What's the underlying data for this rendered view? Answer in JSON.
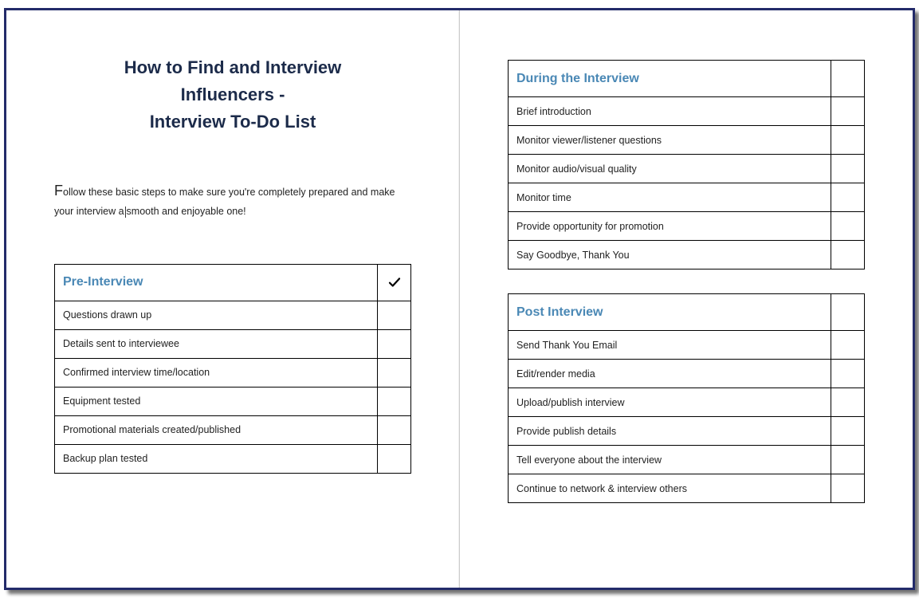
{
  "title": {
    "line1": "How to Find and Interview",
    "line2": "Influencers -",
    "line3": "Interview To-Do List"
  },
  "intro": {
    "first_letter": "F",
    "rest_before_cursor": "ollow these basic steps to make sure you're completely prepared and make your interview a",
    "rest_after_cursor": "smooth and enjoyable one!"
  },
  "sections": {
    "pre": {
      "heading": "Pre-Interview",
      "show_check_icon": true,
      "items": [
        "Questions drawn up",
        "Details sent to interviewee",
        "Confirmed interview time/location",
        "Equipment tested",
        "Promotional materials created/published",
        "Backup plan tested"
      ]
    },
    "during": {
      "heading": "During the Interview",
      "show_check_icon": false,
      "items": [
        "Brief introduction",
        "Monitor viewer/listener questions",
        "Monitor audio/visual quality",
        "Monitor time",
        "Provide opportunity for promotion",
        "Say Goodbye, Thank You"
      ]
    },
    "post": {
      "heading": "Post Interview",
      "show_check_icon": false,
      "items": [
        "Send Thank You Email",
        "Edit/render media",
        "Upload/publish interview",
        "Provide publish details",
        "Tell everyone about the interview",
        "Continue to network & interview others"
      ]
    }
  },
  "colors": {
    "border": "#232b6a",
    "title": "#1c2b4a",
    "section_heading": "#4a88b5"
  }
}
